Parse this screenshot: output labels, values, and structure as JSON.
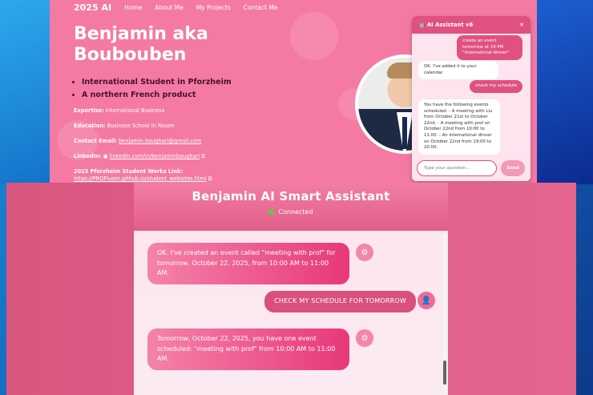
{
  "site": {
    "brand": "2025 AI",
    "nav": [
      "Home",
      "About Me",
      "My Projects",
      "Contact Me"
    ],
    "hero_title": "Benjamin aka Boubouben",
    "bullets": [
      "International Student in Pforzheim",
      "A northern French product"
    ],
    "info": {
      "expertise_label": "Expertise:",
      "expertise": "International Business",
      "education_label": "Education:",
      "education": "Business School in Rouen",
      "email_label": "Contact Email:",
      "email": "benjamin.boughari@gmail.com",
      "linkedin_label": "LinkedIn:",
      "linkedin": "linkedin.com/in/benjaminboughari",
      "works_label": "2025 Pforzheim Student Works Link:",
      "works": "https://PROFluam.github.io/student_websites.html"
    }
  },
  "widget": {
    "title": "AI Assistant v6",
    "close": "✕",
    "messages": [
      {
        "role": "user",
        "text": "create an event tomorrow at 19 PM \"international dinner\""
      },
      {
        "role": "bot",
        "text": "OK. I've added it to your calendar."
      },
      {
        "role": "user",
        "text": "check my schedule"
      },
      {
        "role": "bot",
        "text": "You have the following events scheduled: - A meeting with Liu from October 21st to October 22nd. - A meeting with prof on October 22nd from 10:00 to 11:00. - An international dinner on October 22nd from 19:00 to 20:00."
      }
    ],
    "input_placeholder": "Type your question...",
    "send_label": "Send"
  },
  "app": {
    "title": "Benjamin AI Smart Assistant",
    "status": "Connected",
    "status_color": "#6cc24a",
    "messages": [
      {
        "role": "bot",
        "text": "OK. I've created an event called \"meeting with prof\" for tomorrow, October 22, 2025, from 10:00 AM to 11:00 AM."
      },
      {
        "role": "user",
        "text": "CHECK MY SCHEDULE FOR TOMORROW"
      },
      {
        "role": "bot",
        "text": "Tomorrow, October 22, 2025, you have one event scheduled: \"meeting with prof\" from 10:00 AM to 11:00 AM."
      }
    ]
  },
  "colors": {
    "accent": "#e0517f",
    "page_bg": "#f47aa3"
  }
}
